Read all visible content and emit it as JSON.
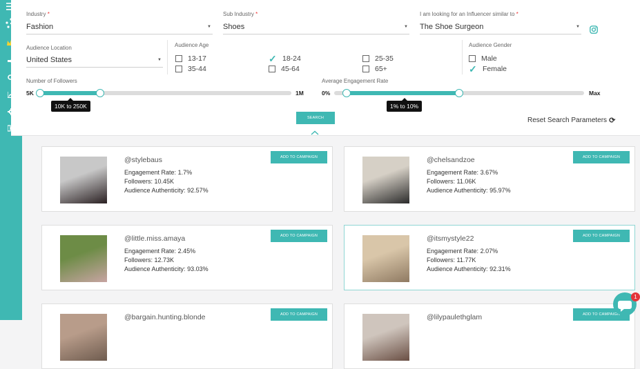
{
  "sidebar": {
    "icons": [
      "menu-icon",
      "network-icon",
      "crown-icon",
      "megaphone-icon",
      "search-icon",
      "chart-icon",
      "gear-icon",
      "logout-icon"
    ]
  },
  "filters": {
    "industry": {
      "label": "Industry",
      "required": "*",
      "value": "Fashion"
    },
    "sub_industry": {
      "label": "Sub Industry",
      "required": "*",
      "value": "Shoes"
    },
    "similar_to": {
      "label": "I am looking for an Influencer similar to",
      "required": "*",
      "value": "The Shoe Surgeon"
    },
    "audience_location": {
      "label": "Audience Location",
      "value": "United States"
    },
    "audience_age": {
      "label": "Audience Age",
      "options": [
        {
          "label": "13-17",
          "checked": false
        },
        {
          "label": "18-24",
          "checked": true
        },
        {
          "label": "25-35",
          "checked": false
        },
        {
          "label": "35-44",
          "checked": false
        },
        {
          "label": "45-64",
          "checked": false
        },
        {
          "label": "65+",
          "checked": false
        }
      ]
    },
    "audience_gender": {
      "label": "Audience Gender",
      "options": [
        {
          "label": "Male",
          "checked": false
        },
        {
          "label": "Female",
          "checked": true
        }
      ]
    },
    "followers": {
      "label": "Number of Followers",
      "min_label": "5K",
      "max_label": "1M",
      "range_text": "10K to 250K",
      "low_fraction": 0.0,
      "high_fraction": 0.24
    },
    "engagement": {
      "label": "Average Engagement Rate",
      "min_label": "0%",
      "max_label": "Max",
      "range_text": "1% to 10%",
      "low_fraction": 0.05,
      "high_fraction": 0.5
    },
    "search_label": "SEARCH",
    "reset_label": "Reset Search Parameters"
  },
  "add_label": "ADD TO CAMPAIGN",
  "stat_labels": {
    "engagement": "Engagement Rate:",
    "followers": "Followers:",
    "authenticity": "Audience Authenticity:"
  },
  "influencers": [
    {
      "handle": "@stylebaus",
      "engagement": "1.7%",
      "followers": "10.45K",
      "authenticity": "92.57%"
    },
    {
      "handle": "@chelsandzoe",
      "engagement": "3.67%",
      "followers": "11.06K",
      "authenticity": "95.97%"
    },
    {
      "handle": "@little.miss.amaya",
      "engagement": "2.45%",
      "followers": "12.73K",
      "authenticity": "93.03%"
    },
    {
      "handle": "@itsmystyle22",
      "engagement": "2.07%",
      "followers": "11.77K",
      "authenticity": "92.31%"
    },
    {
      "handle": "@bargain.hunting.blonde"
    },
    {
      "handle": "@lilypaulethglam"
    }
  ],
  "chat": {
    "badge": "1"
  },
  "colors": {
    "accent": "#3fb8b3",
    "required": "#e33333",
    "badge": "#e4343a"
  }
}
